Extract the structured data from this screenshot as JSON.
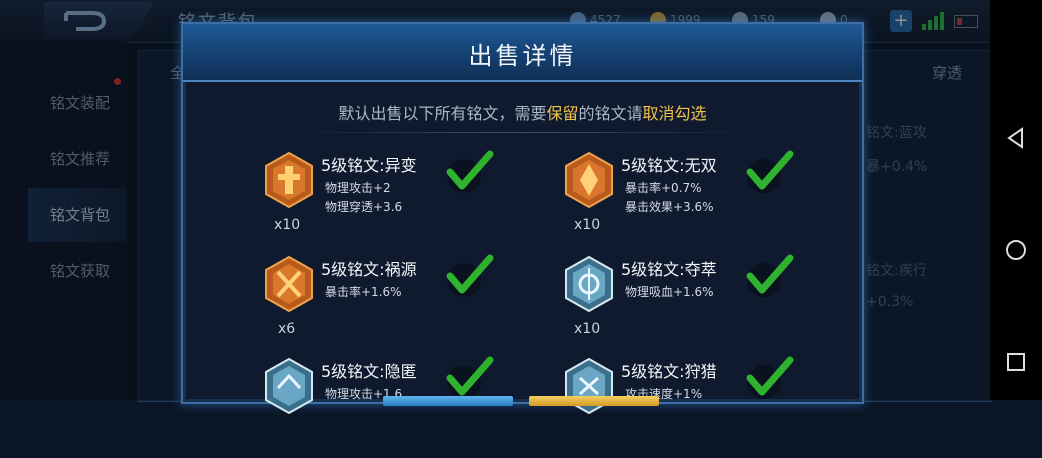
{
  "header": {
    "page_title": "铭文背包",
    "resources": [
      {
        "icon": "gem-icon",
        "value": "4527",
        "color": "#7fa6d6"
      },
      {
        "icon": "coin-icon",
        "value": "1999",
        "color": "#e3b23c"
      },
      {
        "icon": "fragment-icon",
        "value": "159",
        "color": "#9fb3c8"
      },
      {
        "icon": "ticket-icon",
        "value": "0",
        "color": "#b7c4d3"
      }
    ]
  },
  "sidebar": {
    "items": [
      {
        "label": "铭文装配"
      },
      {
        "label": "铭文推荐"
      },
      {
        "label": "铭文背包"
      },
      {
        "label": "铭文获取"
      }
    ]
  },
  "background": {
    "tab_left": "全",
    "tab_right": "穿透",
    "texts": [
      "铭文:蓝攻",
      "暴+0.4%",
      "铭文:疾行",
      "+0.3%"
    ]
  },
  "modal": {
    "title": "出售详情",
    "notice_prefix": "默认出售以下所有铭文，需要",
    "notice_keep": "保留",
    "notice_middle": "的铭文请",
    "notice_uncheck": "取消勾选"
  },
  "runes": [
    {
      "name": "5级铭文:异变",
      "attrs": [
        "物理攻击+2",
        "物理穿透+3.6"
      ],
      "count": "x10",
      "style": "orange",
      "checked": true
    },
    {
      "name": "5级铭文:无双",
      "attrs": [
        "暴击率+0.7%",
        "暴击效果+3.6%"
      ],
      "count": "x10",
      "style": "orange",
      "checked": true
    },
    {
      "name": "5级铭文:祸源",
      "attrs": [
        "暴击率+1.6%"
      ],
      "count": "x6",
      "style": "orange",
      "checked": true
    },
    {
      "name": "5级铭文:夺萃",
      "attrs": [
        "物理吸血+1.6%"
      ],
      "count": "x10",
      "style": "blue",
      "checked": true
    },
    {
      "name": "5级铭文:隐匿",
      "attrs": [
        "物理攻击+1.6"
      ],
      "count": "",
      "style": "blue",
      "checked": true
    },
    {
      "name": "5级铭文:狩猎",
      "attrs": [
        "攻击速度+1%"
      ],
      "count": "",
      "style": "blue",
      "checked": true
    }
  ],
  "colors": {
    "accent": "#3d6fa6",
    "highlight": "#f2c24a",
    "check": "#2fb32f"
  }
}
